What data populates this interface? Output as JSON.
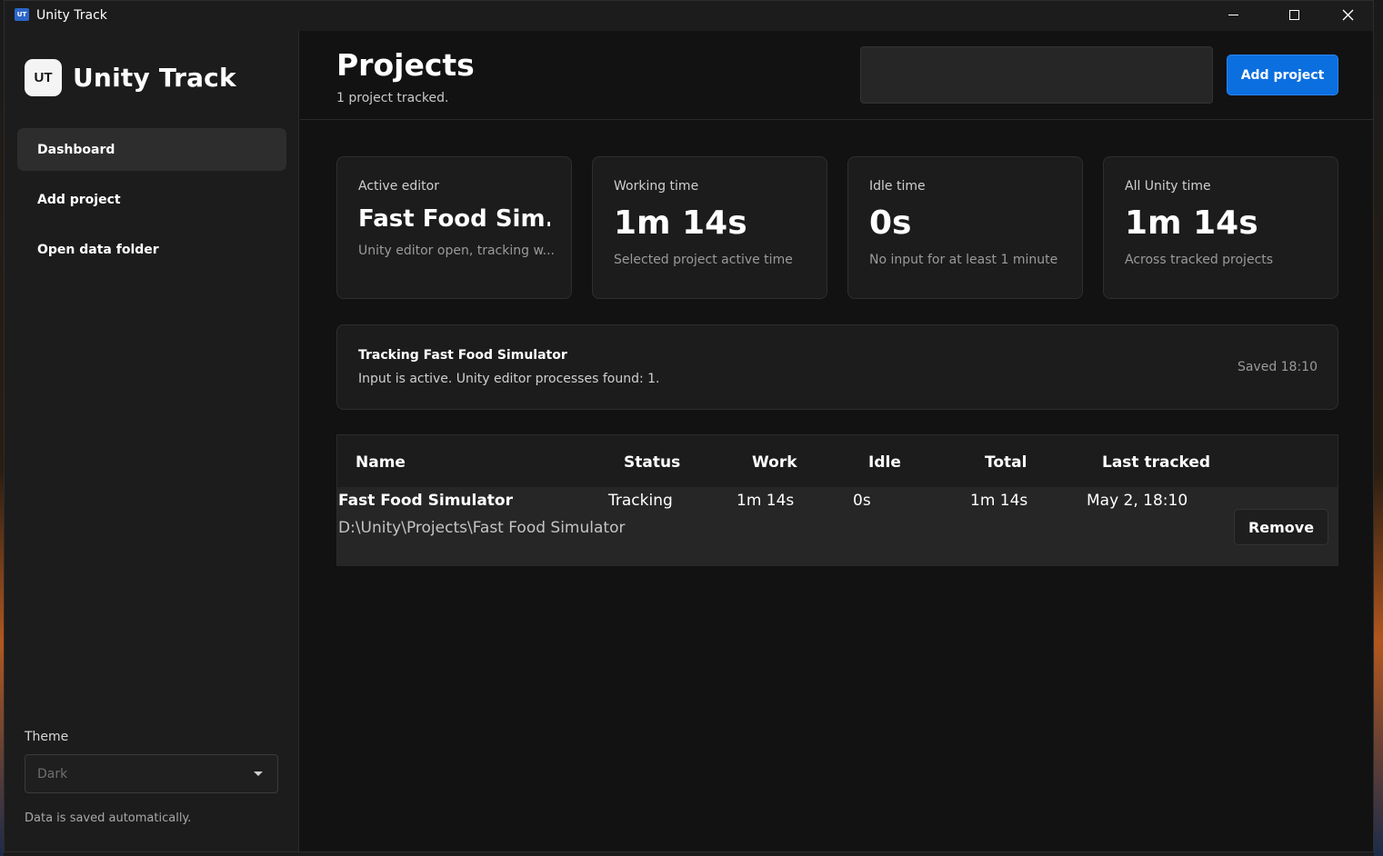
{
  "window": {
    "title": "Unity Track",
    "icon_text": "UT",
    "controls": [
      "minimize-icon",
      "maximize-icon",
      "close-icon"
    ]
  },
  "sidebar": {
    "logo_text": "UT",
    "brand": "Unity Track",
    "nav": [
      {
        "label": "Dashboard",
        "active": true
      },
      {
        "label": "Add project",
        "active": false
      },
      {
        "label": "Open data folder",
        "active": false
      }
    ],
    "theme_label": "Theme",
    "theme_value": "Dark",
    "autosave_note": "Data is saved automatically."
  },
  "header": {
    "title": "Projects",
    "subtitle": "1 project tracked.",
    "search_value": "",
    "add_button": "Add project"
  },
  "stats": [
    {
      "label": "Active editor",
      "value": "Fast Food Sim...",
      "note": "Unity editor open, tracking w..."
    },
    {
      "label": "Working time",
      "value": "1m 14s",
      "note": "Selected project active time"
    },
    {
      "label": "Idle time",
      "value": "0s",
      "note": "No input for at least 1 minute"
    },
    {
      "label": "All Unity time",
      "value": "1m 14s",
      "note": "Across tracked projects"
    }
  ],
  "tracking": {
    "title": "Tracking Fast Food Simulator",
    "detail": "Input is active. Unity editor processes found: 1.",
    "saved": "Saved 18:10"
  },
  "table": {
    "columns": [
      "Name",
      "Status",
      "Work",
      "Idle",
      "Total",
      "Last tracked"
    ],
    "rows": [
      {
        "name": "Fast Food Simulator",
        "path": "D:\\Unity\\Projects\\Fast Food Simulator",
        "status": "Tracking",
        "work": "1m 14s",
        "idle": "0s",
        "total": "1m 14s",
        "last_tracked": "May 2, 18:10",
        "action": "Remove"
      }
    ]
  },
  "colors": {
    "accent": "#0b6fe0",
    "sidebar_bg": "#1c1c1c",
    "main_bg": "#121212"
  }
}
